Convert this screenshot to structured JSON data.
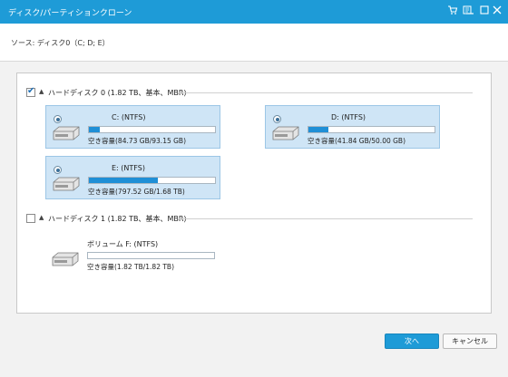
{
  "window": {
    "title": "ディスク/パーティションクローン",
    "controls": [
      "cart-icon",
      "help-icon",
      "minimize-icon",
      "maximize-icon",
      "close-icon"
    ]
  },
  "source": {
    "label": "ソース: ディスク0（C; D; E）"
  },
  "disks": [
    {
      "header": "ハードディスク 0 (1.82 TB、基本、MBR)",
      "checked": true,
      "partitions": [
        {
          "name": "C: (NTFS)",
          "free": "空き容量(84.73 GB/93.15 GB)",
          "selected": true,
          "used_fraction": 0.09
        },
        {
          "name": "D: (NTFS)",
          "free": "空き容量(41.84 GB/50.00 GB)",
          "selected": true,
          "used_fraction": 0.16
        },
        {
          "name": "E: (NTFS)",
          "free": "空き容量(797.52 GB/1.68 TB)",
          "selected": true,
          "used_fraction": 0.54
        }
      ]
    },
    {
      "header": "ハードディスク 1 (1.82 TB、基本、MBR)",
      "checked": false,
      "partitions": [
        {
          "name": "ボリューム F: (NTFS)",
          "free": "空き容量(1.82 TB/1.82 TB)",
          "selected": false,
          "used_fraction": 0.0
        }
      ]
    }
  ],
  "buttons": {
    "next": "次へ",
    "cancel": "キャンセル"
  },
  "colors": {
    "accent": "#1e9bd7",
    "selection": "#cfe5f6",
    "bar_fill": "#1f8fd6"
  }
}
